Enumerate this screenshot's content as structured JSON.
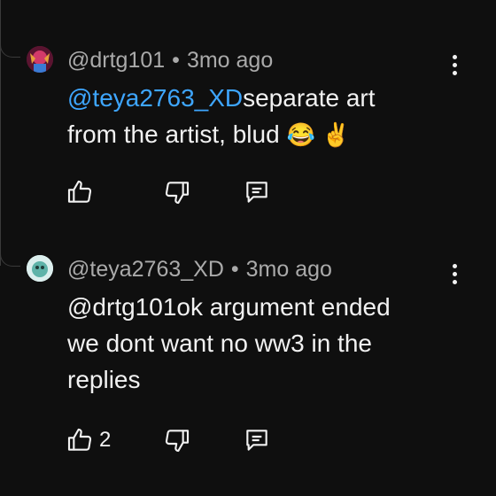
{
  "comments": [
    {
      "author": "@drtg101",
      "separator": "•",
      "time": "3mo ago",
      "mention": "@teya2763_XD",
      "text_line1": "separate art",
      "text_line2": "from the artist, blud",
      "emoji": "😂 ✌️",
      "like_count": ""
    },
    {
      "author": "@teya2763_XD",
      "separator": "•",
      "time": "3mo ago",
      "mention": "@drtg101",
      "text_line1": "ok argument ended",
      "text_line2": "we dont want no ww3 in the",
      "text_line3": "replies",
      "like_count": "2"
    }
  ],
  "icons": {
    "like": "thumbs-up-icon",
    "dislike": "thumbs-down-icon",
    "reply": "reply-icon",
    "more": "more-vertical-icon"
  },
  "colors": {
    "background": "#0f0f0f",
    "mention": "#3ea6ff",
    "meta": "#aaaaaa",
    "text": "#f1f1f1"
  }
}
